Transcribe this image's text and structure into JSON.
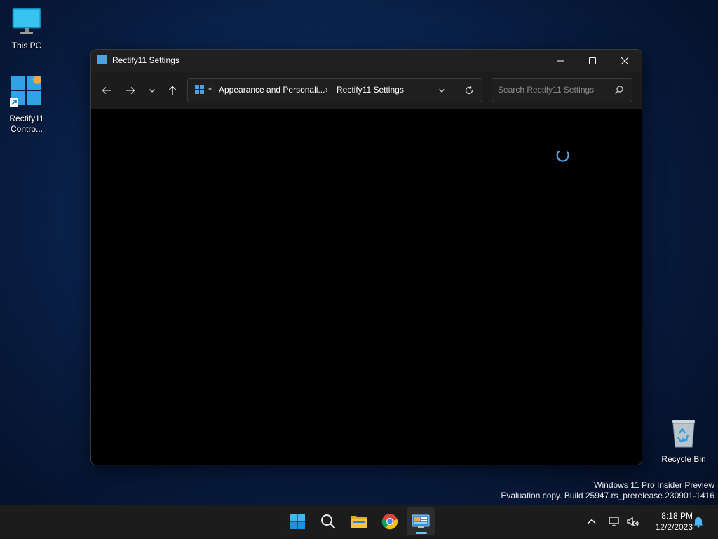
{
  "desktop": {
    "icons": [
      {
        "label": "This PC",
        "icon": "monitor-icon"
      },
      {
        "label": "Rectify11 Contro...",
        "icon": "windows-logo-shortcut-icon"
      },
      {
        "label": "Recycle Bin",
        "icon": "recycle-bin-icon"
      }
    ],
    "watermark": {
      "line1": "Windows 11 Pro Insider Preview",
      "line2": "Evaluation copy. Build 25947.rs_prerelease.230901-1416"
    }
  },
  "window": {
    "title": "Rectify11 Settings",
    "controls": {
      "minimize": "minimize-icon",
      "maximize": "maximize-icon",
      "close": "close-icon"
    },
    "nav": {
      "back": "arrow-left-icon",
      "forward": "arrow-right-icon",
      "recent": "chevron-down-icon",
      "up": "arrow-up-icon"
    },
    "address": {
      "overflow": "«",
      "crumbs": [
        "Appearance and Personali...",
        "Rectify11 Settings"
      ],
      "separator": "›"
    },
    "search": {
      "placeholder": "Search Rectify11 Settings",
      "value": ""
    },
    "content": {
      "state": "loading",
      "spinner_color": "#5aa7e8"
    }
  },
  "taskbar": {
    "apps": [
      "start",
      "search",
      "file-explorer",
      "chrome",
      "control-panel"
    ],
    "active_app": "control-panel",
    "clock": {
      "time": "8:18 PM",
      "date": "12/2/2023"
    },
    "accent_color": "#60cdff"
  }
}
